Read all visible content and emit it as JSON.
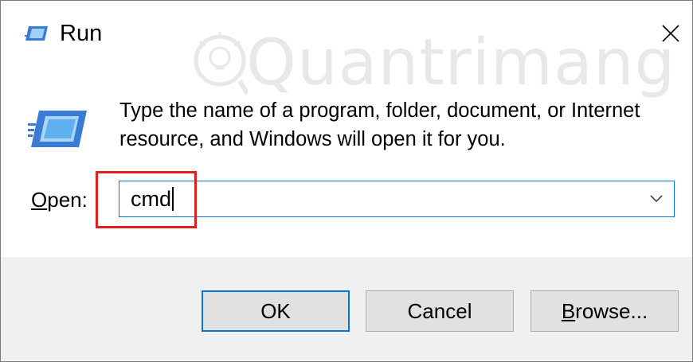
{
  "window": {
    "title": "Run",
    "title_icon": "run-icon",
    "close_icon": "close-icon"
  },
  "watermark": {
    "text": "Quantrimang"
  },
  "prompt": {
    "line1": "Type the name of a program, folder, document, or Internet",
    "line2": "resource, and Windows will open it for you."
  },
  "open": {
    "label_accel": "O",
    "label_rest": "pen:",
    "value": "cmd",
    "dropdown_icon": "chevron-down-icon"
  },
  "buttons": {
    "ok": "OK",
    "cancel": "Cancel",
    "browse_accel": "B",
    "browse_rest": "rowse..."
  },
  "colors": {
    "focus_blue": "#0078d7",
    "highlight_red": "#e0201e",
    "footer_bg": "#f0f0f0",
    "button_bg": "#e1e1e1"
  }
}
